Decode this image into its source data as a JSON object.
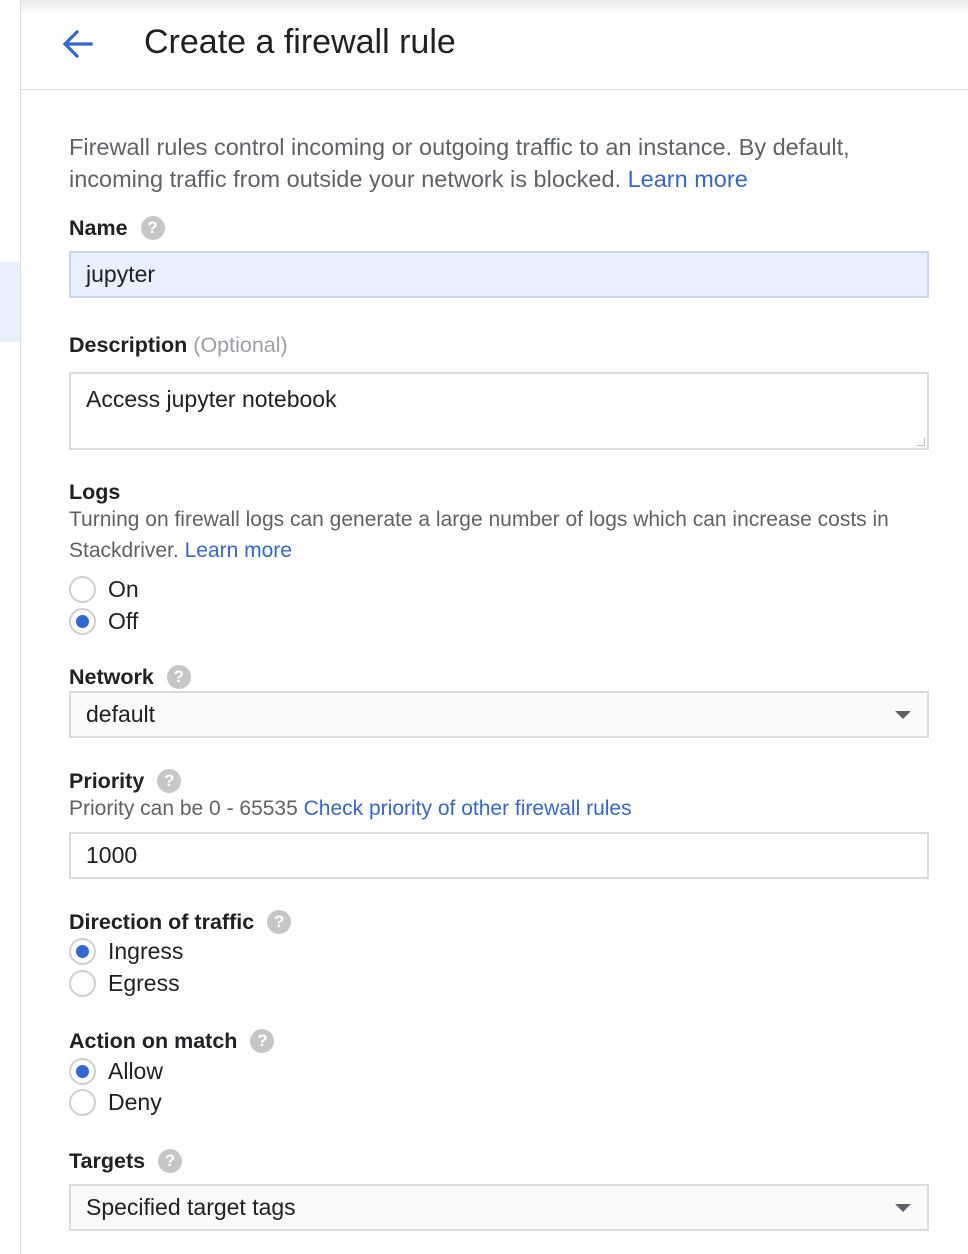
{
  "header": {
    "title": "Create a firewall rule"
  },
  "intro": {
    "text": "Firewall rules control incoming or outgoing traffic to an instance. By default, incoming traffic from outside your network is blocked.",
    "learn_more": "Learn more"
  },
  "name": {
    "label": "Name",
    "value": "jupyter"
  },
  "description": {
    "label": "Description",
    "optional": "(Optional)",
    "value": "Access jupyter notebook"
  },
  "logs": {
    "label": "Logs",
    "help": "Turning on firewall logs can generate a large number of logs which can increase costs in Stackdriver.",
    "learn_more": "Learn more",
    "options": [
      {
        "label": "On",
        "checked": false
      },
      {
        "label": "Off",
        "checked": true
      }
    ]
  },
  "network": {
    "label": "Network",
    "value": "default"
  },
  "priority": {
    "label": "Priority",
    "help": "Priority can be 0 - 65535",
    "link": "Check priority of other firewall rules",
    "value": "1000"
  },
  "direction": {
    "label": "Direction of traffic",
    "options": [
      {
        "label": "Ingress",
        "checked": true
      },
      {
        "label": "Egress",
        "checked": false
      }
    ]
  },
  "action": {
    "label": "Action on match",
    "options": [
      {
        "label": "Allow",
        "checked": true
      },
      {
        "label": "Deny",
        "checked": false
      }
    ]
  },
  "targets": {
    "label": "Targets",
    "value": "Specified target tags"
  },
  "icons": {
    "back": "arrow-back-icon",
    "help": "help-icon",
    "dropdown": "dropdown-caret-icon"
  },
  "colors": {
    "accent": "#3367d6",
    "selected_field": "#e8f0fe"
  }
}
